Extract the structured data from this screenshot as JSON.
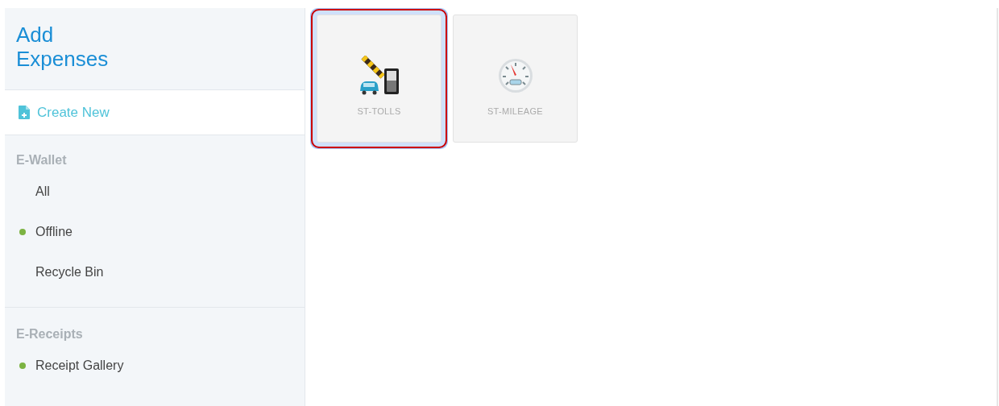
{
  "sidebar": {
    "title": "Add Expenses",
    "create_new": {
      "label": "Create New"
    },
    "sections": [
      {
        "heading": "E-Wallet",
        "items": [
          {
            "label": "All",
            "status_dot": false
          },
          {
            "label": "Offline",
            "status_dot": true
          },
          {
            "label": "Recycle Bin",
            "status_dot": false
          }
        ]
      },
      {
        "heading": "E-Receipts",
        "items": [
          {
            "label": "Receipt Gallery",
            "status_dot": true
          }
        ]
      }
    ]
  },
  "tiles": [
    {
      "label": "ST-TOLLS",
      "kind": "tolls",
      "selected": true
    },
    {
      "label": "ST-MILEAGE",
      "kind": "mileage",
      "selected": false
    }
  ]
}
